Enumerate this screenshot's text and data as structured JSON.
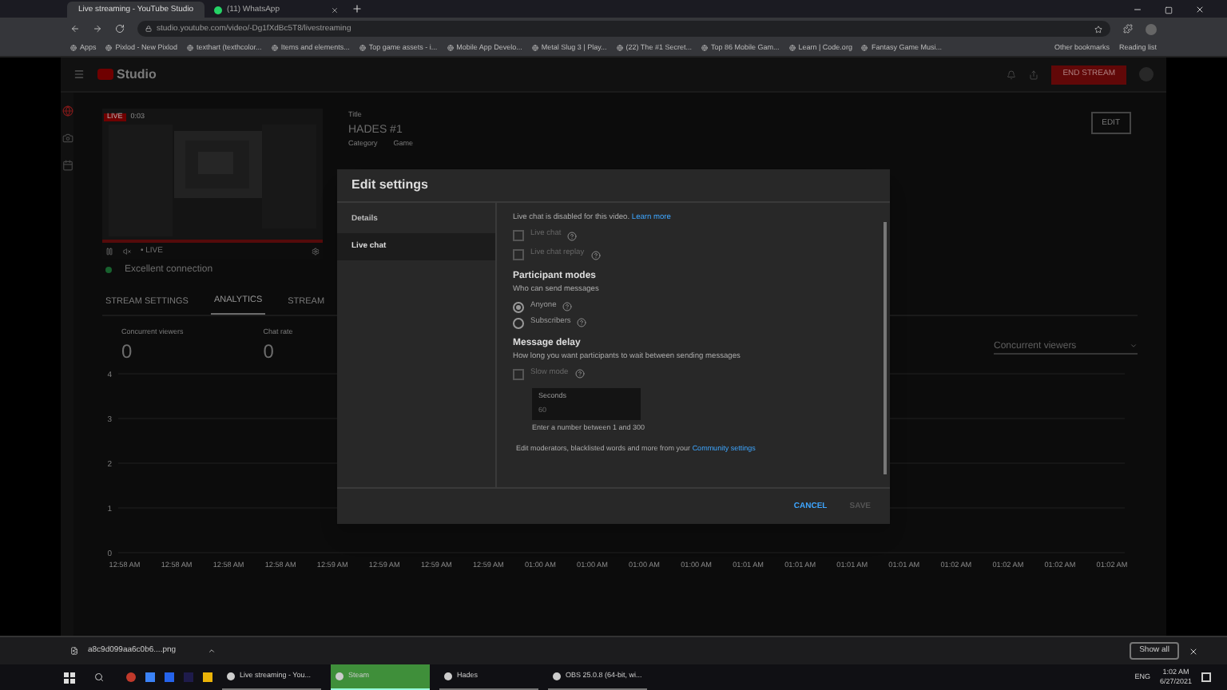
{
  "browser": {
    "tabs": [
      {
        "title": "Live streaming - YouTube Studio",
        "selected": true
      },
      {
        "title": "(11) WhatsApp",
        "selected": false
      }
    ],
    "url": "studio.youtube.com/video/-Dg1fXdBc5T8/livestreaming",
    "bookmarks": [
      "Apps",
      "Pixlod - New Pixlod",
      "texthart (texthcolor...",
      "Items and elements...",
      "Top game assets - i...",
      "Mobile App Develo...",
      "Metal Slug 3 | Play...",
      "(22) The #1 Secret...",
      "Top 86 Mobile Gam...",
      "Learn | Code.org",
      "Fantasy Game Musi..."
    ],
    "bookmarks_right": [
      "Other bookmarks",
      "Reading list"
    ]
  },
  "studio": {
    "logo": "Studio",
    "end_stream": "END STREAM",
    "rail": [
      {
        "selected": true
      },
      {
        "selected": false
      },
      {
        "selected": false
      }
    ],
    "preview": {
      "badge": "LIVE",
      "time": "0:03",
      "live_label": "• LIVE"
    },
    "connection": "Excellent connection",
    "title_label": "Title",
    "title": "HADES #1",
    "category_label": "Category",
    "category": "Game",
    "edit": "EDIT",
    "tabs": [
      {
        "label": "STREAM SETTINGS",
        "selected": false
      },
      {
        "label": "ANALYTICS",
        "selected": true
      },
      {
        "label": "STREAM",
        "selected": false
      }
    ],
    "stats": [
      {
        "label": "Concurrent viewers",
        "value": "0"
      },
      {
        "label": "Chat rate",
        "value": "0"
      }
    ],
    "metric_select": "Concurrent viewers",
    "chart_data": {
      "type": "line",
      "categories": [
        "12:58 AM",
        "12:58 AM",
        "12:58 AM",
        "12:58 AM",
        "12:59 AM",
        "12:59 AM",
        "12:59 AM",
        "12:59 AM",
        "01:00 AM",
        "01:00 AM",
        "01:00 AM",
        "01:00 AM",
        "01:01 AM",
        "01:01 AM",
        "01:01 AM",
        "01:01 AM",
        "01:02 AM",
        "01:02 AM",
        "01:02 AM",
        "01:02 AM"
      ],
      "ylim": [
        0,
        4
      ],
      "yticks": [
        0,
        1,
        2,
        3,
        4
      ],
      "grid": true
    }
  },
  "dialog": {
    "title": "Edit settings",
    "nav": [
      {
        "label": "Details",
        "selected": false
      },
      {
        "label": "Live chat",
        "selected": true
      }
    ],
    "disabled_note": "Live chat is disabled for this video.",
    "learn_more": "Learn more",
    "chat_options": [
      {
        "label": "Live chat",
        "checked": false,
        "disabled": true
      },
      {
        "label": "Live chat replay",
        "checked": false,
        "disabled": true
      }
    ],
    "participant_title": "Participant modes",
    "participant_hint": "Who can send messages",
    "modes": [
      {
        "label": "Anyone",
        "selected": true
      },
      {
        "label": "Subscribers",
        "selected": false
      }
    ],
    "delay_title": "Message delay",
    "delay_hint": "How long you want participants to wait between sending messages",
    "slow_mode": {
      "label": "Slow mode",
      "checked": false,
      "disabled": true
    },
    "seconds_label": "Seconds",
    "seconds_value": "60",
    "seconds_help": "Enter a number between 1 and 300",
    "community_note": "Edit moderators, blacklisted words and more from your",
    "community_link": "Community settings",
    "buttons": [
      {
        "label": "CANCEL",
        "disabled": false
      },
      {
        "label": "SAVE",
        "disabled": true
      }
    ]
  },
  "download": {
    "file": "a8c9d099aa6c0b6....png",
    "show_all": "Show all"
  },
  "taskbar": {
    "apps": [
      {
        "label": "Live streaming - You...",
        "selected": false
      },
      {
        "label": "Steam",
        "selected": true
      },
      {
        "label": "Hades",
        "selected": false
      },
      {
        "label": "OBS 25.0.8 (64-bit, wi...",
        "selected": false
      }
    ],
    "lang": "ENG",
    "time": "1:02 AM",
    "date": "6/27/2021"
  }
}
